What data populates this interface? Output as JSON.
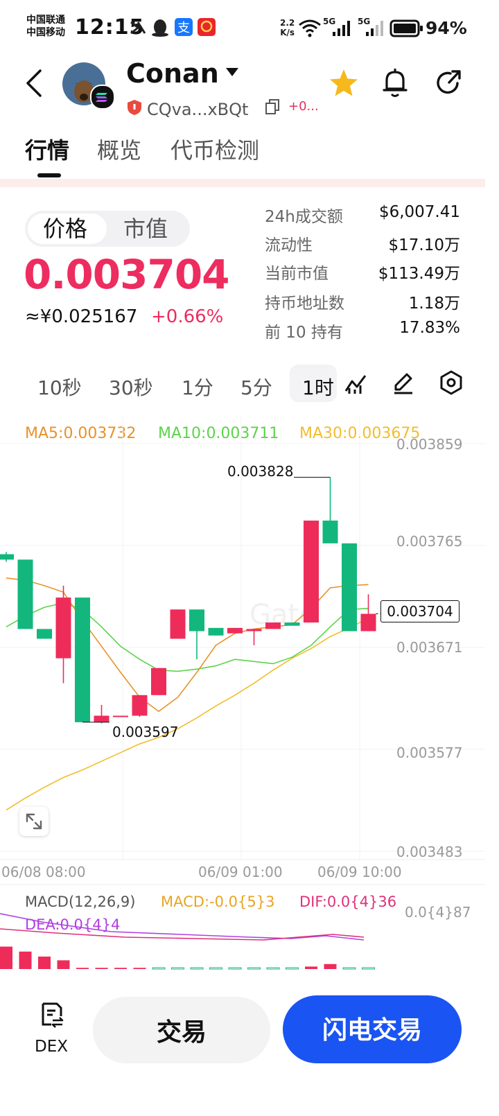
{
  "status_bar": {
    "carrier_1": "中国联通",
    "carrier_2": "中国移动",
    "time": "12:15",
    "net_speed": "2.2",
    "net_unit": "K/s",
    "signal_1": "5G",
    "signal_2": "5G",
    "battery": "94%"
  },
  "header": {
    "token_name": "Conan",
    "address": "CQva...xBQt",
    "plus_tag": "+0...",
    "icons": [
      "back-icon",
      "chevron-down-icon",
      "copy-icon",
      "star-icon",
      "bell-icon",
      "share-icon"
    ],
    "star_color": "#f5b91c"
  },
  "tabs": [
    {
      "label": "行情"
    },
    {
      "label": "概览"
    },
    {
      "label": "代币检测"
    }
  ],
  "price_toggle": {
    "price_label": "价格",
    "mcap_label": "市值"
  },
  "price": {
    "value": "0.003704",
    "cny": "≈¥0.025167",
    "change": "+0.66%",
    "color": "#ed2c5f"
  },
  "stats": [
    {
      "label": "24h成交额",
      "value": "$6,007.41"
    },
    {
      "label": "流动性",
      "value": "$17.10万"
    },
    {
      "label": "当前市值",
      "value": "$113.49万"
    },
    {
      "label": "持币地址数",
      "value": "1.18万"
    },
    {
      "label": "前 10 持有",
      "value": "17.83%"
    }
  ],
  "intervals": [
    {
      "label": "10秒"
    },
    {
      "label": "30秒"
    },
    {
      "label": "1分"
    },
    {
      "label": "5分"
    },
    {
      "label": "1时"
    }
  ],
  "chart_tools": [
    "indicator-icon",
    "draw-icon",
    "settings-icon"
  ],
  "chart_data": {
    "type": "candlestick",
    "ma_legend": {
      "ma5": "MA5:0.003732",
      "ma10": "MA10:0.003711",
      "ma30": "MA30:0.003675"
    },
    "colors": {
      "up": "#ee2c5a",
      "down": "#13b77d",
      "ma5": "#e8922a",
      "ma10": "#5cd34a",
      "ma30": "#f2bd2c"
    },
    "y_ticks": [
      "0.003859",
      "0.003765",
      "0.003671",
      "0.003577",
      "0.003483"
    ],
    "ylim": [
      0.003483,
      0.003859
    ],
    "x_ticks": [
      "06/08 08:00",
      "06/09 01:00",
      "06/09 10:00"
    ],
    "high_label": "0.003828",
    "low_label": "0.003597",
    "current_label": "0.003704",
    "candles": [
      {
        "o": 0.003757,
        "c": 0.003752,
        "h": 0.003759,
        "l": 0.00375
      },
      {
        "o": 0.003752,
        "c": 0.003688,
        "h": 0.003752,
        "l": 0.003688
      },
      {
        "o": 0.003688,
        "c": 0.003679,
        "h": 0.003688,
        "l": 0.003679
      },
      {
        "o": 0.003661,
        "c": 0.003717,
        "h": 0.003728,
        "l": 0.003638
      },
      {
        "o": 0.003717,
        "c": 0.003602,
        "h": 0.003717,
        "l": 0.003602
      },
      {
        "o": 0.003602,
        "c": 0.003608,
        "h": 0.003618,
        "l": 0.003601
      },
      {
        "o": 0.003607,
        "c": 0.003608,
        "h": 0.003608,
        "l": 0.003607
      },
      {
        "o": 0.003608,
        "c": 0.003627,
        "h": 0.003627,
        "l": 0.003607
      },
      {
        "o": 0.003627,
        "c": 0.003652,
        "h": 0.003652,
        "l": 0.003627
      },
      {
        "o": 0.003679,
        "c": 0.003706,
        "h": 0.003706,
        "l": 0.003679
      },
      {
        "o": 0.003706,
        "c": 0.003686,
        "h": 0.003706,
        "l": 0.00366
      },
      {
        "o": 0.003689,
        "c": 0.003682,
        "h": 0.003689,
        "l": 0.003682
      },
      {
        "o": 0.003684,
        "c": 0.003689,
        "h": 0.003689,
        "l": 0.003684
      },
      {
        "o": 0.003686,
        "c": 0.003688,
        "h": 0.003688,
        "l": 0.003673
      },
      {
        "o": 0.003688,
        "c": 0.003694,
        "h": 0.003694,
        "l": 0.003688
      },
      {
        "o": 0.003694,
        "c": 0.003691,
        "h": 0.003694,
        "l": 0.003691
      },
      {
        "o": 0.003694,
        "c": 0.003788,
        "h": 0.003788,
        "l": 0.003694
      },
      {
        "o": 0.003788,
        "c": 0.003767,
        "h": 0.003828,
        "l": 0.003767
      },
      {
        "o": 0.003767,
        "c": 0.003686,
        "h": 0.003767,
        "l": 0.003686
      },
      {
        "o": 0.003686,
        "c": 0.003702,
        "h": 0.00372,
        "l": 0.003686
      }
    ],
    "ma5": [
      0.003735,
      0.003733,
      0.003728,
      0.003722,
      0.003696,
      0.003672,
      0.003648,
      0.003625,
      0.003612,
      0.003625,
      0.003648,
      0.003673,
      0.003684,
      0.003688,
      0.00369,
      0.003692,
      0.003707,
      0.003726,
      0.003728,
      0.003729
    ],
    "ma10": [
      0.00369,
      0.0037,
      0.003708,
      0.003712,
      0.003706,
      0.00369,
      0.003672,
      0.00366,
      0.00365,
      0.003649,
      0.003651,
      0.003654,
      0.00366,
      0.003658,
      0.003656,
      0.003662,
      0.003673,
      0.00369,
      0.003706,
      0.003707
    ],
    "ma30": [
      0.003521,
      0.003532,
      0.003542,
      0.003551,
      0.003558,
      0.003566,
      0.003574,
      0.003582,
      0.003588,
      0.003596,
      0.003606,
      0.003617,
      0.003627,
      0.003638,
      0.00365,
      0.003661,
      0.00367,
      0.003681,
      0.003689,
      0.003698
    ],
    "macd": {
      "legend": "MACD(12,26,9)",
      "macd_label": "MACD:-0.0{5}3",
      "dif_label": "DIF:0.0{4}36",
      "dea_label": "DEA:0.0{4}4",
      "y_tick": "0.0{4}87",
      "colors": {
        "macd": "#e8a522",
        "dif": "#e0307a",
        "dea": "#b040e0"
      },
      "hist": [
        -0.9,
        -0.7,
        -0.5,
        -0.35,
        -0.05,
        -0.05,
        -0.05,
        -0.05,
        0.05,
        0.05,
        0.05,
        0.05,
        0.05,
        0.05,
        0.05,
        0.05,
        -0.1,
        -0.2,
        0.05,
        0.05
      ]
    }
  },
  "bottom_bar": {
    "dex_label": "DEX",
    "trade_label": "交易",
    "flash_label": "闪电交易",
    "flash_color": "#1a54f2"
  }
}
